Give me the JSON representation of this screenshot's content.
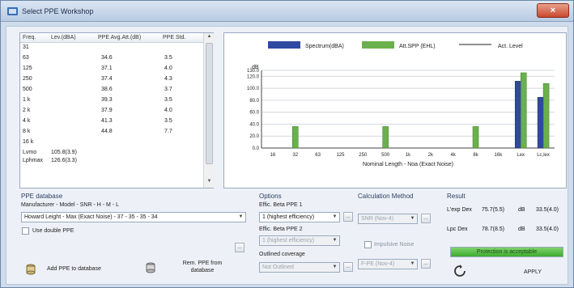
{
  "window": {
    "title": "Select PPE Workshop",
    "close_label": "×"
  },
  "list": {
    "headers": [
      "Freq.",
      "Lev.(dBA)",
      "PPE Avg.Att.(dB)",
      "PPE Std."
    ],
    "rows": [
      [
        "31",
        "",
        "",
        ""
      ],
      [
        "63",
        "",
        "34.6",
        "3.5"
      ],
      [
        "125",
        "",
        "37.1",
        "4.0"
      ],
      [
        "250",
        "",
        "37.4",
        "4.3"
      ],
      [
        "500",
        "",
        "38.6",
        "3.7"
      ],
      [
        "1 k",
        "",
        "39.3",
        "3.5"
      ],
      [
        "2 k",
        "",
        "37.9",
        "4.0"
      ],
      [
        "4 k",
        "",
        "41.3",
        "3.5"
      ],
      [
        "8 k",
        "",
        "44.8",
        "7.7"
      ],
      [
        "16 k",
        "",
        "",
        ""
      ]
    ],
    "summary": [
      {
        "label": "Lvmo",
        "value": "105.8(3.9)"
      },
      {
        "label": "Lphmax",
        "value": "126.6(3.3)"
      }
    ]
  },
  "chart_data": {
    "type": "bar",
    "categories": [
      "16",
      "32",
      "63",
      "125",
      "250",
      "500",
      "1k",
      "2k",
      "4k",
      "8k",
      "16k",
      "Lex",
      "Lc,lex"
    ],
    "series": [
      {
        "name": "Spectrum(dBA)",
        "color": "#3049a0",
        "values": [
          0,
          0,
          0,
          0,
          0,
          0,
          0,
          0,
          0,
          0,
          0,
          112,
          85
        ]
      },
      {
        "name": "Att.SPP (EHL)",
        "color": "#6ab04c",
        "values": [
          0,
          36,
          0,
          0,
          0,
          36,
          0,
          0,
          0,
          36,
          0,
          126,
          108
        ]
      }
    ],
    "legend_extra": "Act. Level",
    "ylabel": "dB",
    "xlabel": "Nominal Length - Noa (Exact Noise)",
    "yticks": [
      "0.0",
      "20.0",
      "40.0",
      "60.0",
      "80.0",
      "100.0",
      "120.0",
      "130.0"
    ],
    "ylim": [
      0,
      130
    ]
  },
  "ppe_database": {
    "title": "PPE database",
    "filter_row": "Manufacturer - Model - SNR - H - M - L",
    "selected": "Howard Leight - Max (Exact Noise) - 37 - 35 - 35 - 34",
    "use_double_label": "Use double PPE",
    "add_button": "Add PPE to database",
    "rem_button": "Rem. PPE from database"
  },
  "options": {
    "title": "Options",
    "eff_ppe1_label": "Effic. Beta PPE 1",
    "eff_ppe1_value": "1 (highest efficiency)",
    "eff_ppe2_label": "Effic. Beta PPE 2",
    "eff_ppe2_value": "1 (highest efficiency)",
    "outlined_label": "Outlined coverage",
    "outlined_value": "Not Outlined"
  },
  "calculation": {
    "title": "Calculation Method",
    "method_value": "SNR (Nov-4)",
    "checkbox_label": "Impulsive Noise",
    "standard_value": "F-PE (Nov-4)"
  },
  "result": {
    "title": "Result",
    "rows": [
      {
        "label": "L'exp Dex",
        "value": "75.7(5.5)",
        "unit": "dB",
        "value2": "33.5(4.0)"
      },
      {
        "label": "Lpc Dex",
        "value": "78.7(8.5)",
        "unit": "dB",
        "value2": "33.5(4.0)"
      }
    ],
    "progress_fraction": 1.0,
    "progress_text": "Protection is acceptable",
    "apply_label": "APPLY"
  }
}
